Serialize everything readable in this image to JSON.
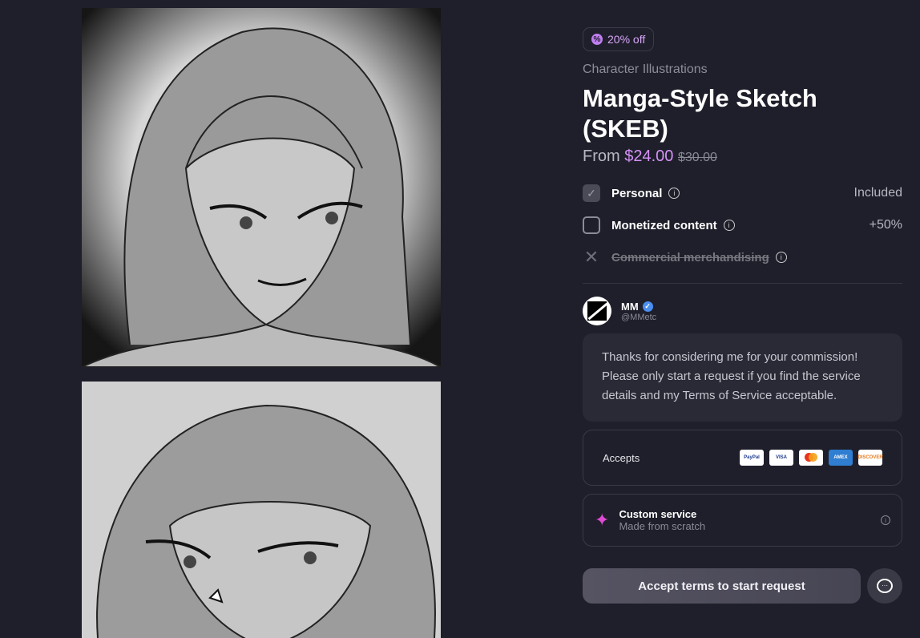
{
  "gallery": {
    "image1_alt": "manga-style sketch of a girl with blush",
    "image2_alt": "manga-style sketch of a girl, second view"
  },
  "badge": {
    "label": "20% off",
    "icon": "discount-icon"
  },
  "product": {
    "category": "Character Illustrations",
    "title": "Manga-Style Sketch (SKEB)",
    "price_prefix": "From",
    "price_now": "$24.00",
    "price_old": "$30.00"
  },
  "options": [
    {
      "label": "Personal",
      "right": "Included",
      "state": "checked"
    },
    {
      "label": "Monetized content",
      "right": "+50%",
      "state": "empty"
    },
    {
      "label": "Commercial merchandising",
      "right": "",
      "state": "disabled"
    }
  ],
  "artist": {
    "name": "MM",
    "handle": "@MMetc"
  },
  "message": "Thanks for considering me for your commission! Please only start a request if you find the service details and my Terms of Service acceptable.",
  "accepts": {
    "label": "Accepts",
    "methods": [
      "PayPal",
      "VISA",
      "Mastercard",
      "AMEX",
      "DISCOVER"
    ]
  },
  "service": {
    "title": "Custom service",
    "subtitle": "Made from scratch"
  },
  "cta": {
    "label": "Accept terms to start request"
  },
  "colors": {
    "accent": "#d592f6",
    "background": "#1f1f2b",
    "card": "#2a2a36"
  }
}
